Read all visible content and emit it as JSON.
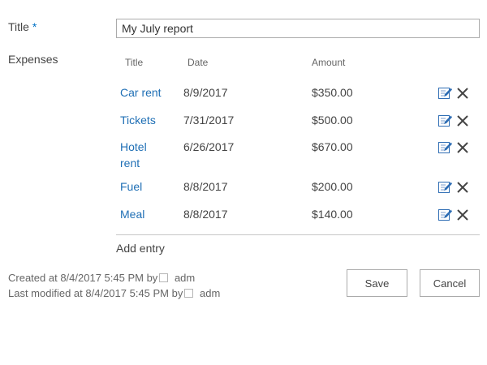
{
  "form": {
    "title_label": "Title",
    "required_marker": "*",
    "title_value": "My July report",
    "expenses_label": "Expenses"
  },
  "expenses": {
    "columns": {
      "title": "Title",
      "date": "Date",
      "amount": "Amount"
    },
    "rows": [
      {
        "title": "Car rent",
        "date": "8/9/2017",
        "amount": "$350.00"
      },
      {
        "title": "Tickets",
        "date": "7/31/2017",
        "amount": "$500.00"
      },
      {
        "title": "Hotel rent",
        "date": "6/26/2017",
        "amount": "$670.00"
      },
      {
        "title": "Fuel",
        "date": "8/8/2017",
        "amount": "$200.00"
      },
      {
        "title": "Meal",
        "date": "8/8/2017",
        "amount": "$140.00"
      }
    ],
    "add_entry": "Add entry"
  },
  "meta": {
    "created_text": "Created at 8/4/2017 5:45 PM",
    "created_by": "by",
    "created_user": "adm",
    "modified_text": "Last modified at 8/4/2017 5:45 PM",
    "modified_by": "by",
    "modified_user": "adm"
  },
  "buttons": {
    "save": "Save",
    "cancel": "Cancel"
  },
  "icons": {
    "edit": "edit-icon",
    "delete": "delete-icon"
  },
  "colors": {
    "link": "#1f6fb5",
    "required": "#0072c6",
    "edit_icon": "#2e6db4",
    "delete_icon": "#444444"
  }
}
